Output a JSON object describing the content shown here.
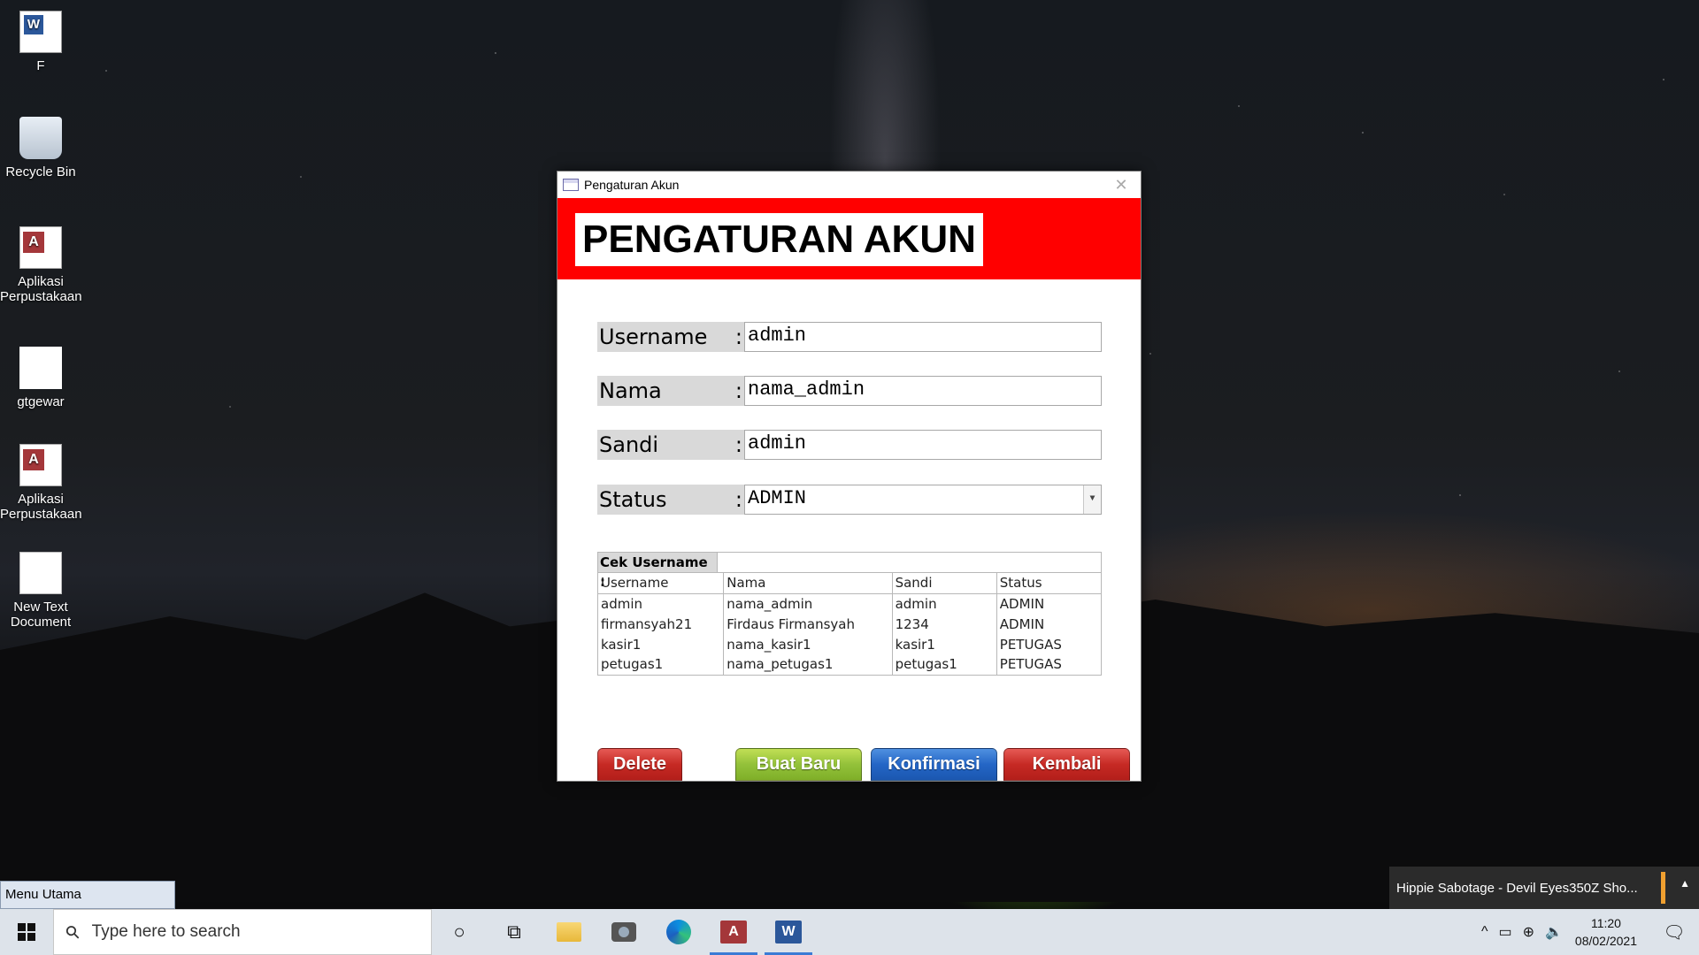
{
  "desktop": {
    "icons": [
      {
        "label": "F",
        "icon": "word-document-icon"
      },
      {
        "label": "Recycle Bin",
        "icon": "recycle-bin-icon"
      },
      {
        "label": "Aplikasi Perpustakaan",
        "icon": "access-database-icon"
      },
      {
        "label": "gtgewar",
        "icon": "blank-file-icon"
      },
      {
        "label": "Aplikasi Perpustakaan",
        "icon": "access-locked-database-icon"
      },
      {
        "label": "New Text Document",
        "icon": "text-document-icon"
      }
    ]
  },
  "window": {
    "title": "Pengaturan Akun",
    "header": "PENGATURAN AKUN",
    "fields": [
      {
        "label": "Username",
        "value": "admin"
      },
      {
        "label": "Nama",
        "value": "nama_admin"
      },
      {
        "label": "Sandi",
        "value": "admin"
      },
      {
        "label": "Status",
        "value": "ADMIN"
      }
    ],
    "colon": ":",
    "cek_label": "Cek Username :",
    "cek_value": "",
    "table": {
      "headers": [
        "Username",
        "Nama",
        "Sandi",
        "Status"
      ],
      "rows": [
        [
          "admin",
          "nama_admin",
          "admin",
          "ADMIN"
        ],
        [
          "firmansyah21",
          "Firdaus Firmansyah",
          "1234",
          "ADMIN"
        ],
        [
          "kasir1",
          "nama_kasir1",
          "kasir1",
          "PETUGAS"
        ],
        [
          "petugas1",
          "nama_petugas1",
          "petugas1",
          "PETUGAS"
        ]
      ]
    },
    "buttons": {
      "delete": "Delete",
      "new": "Buat Baru",
      "confirm": "Konfirmasi",
      "back": "Kembali"
    },
    "colors": {
      "header": "#ff0000",
      "red_button": "#c62a24",
      "green_button": "#93c13a",
      "blue_button": "#2466c6"
    }
  },
  "minimized_form": "Menu Utama",
  "notification": "Hippie Sabotage - Devil Eyes350Z Sho...",
  "taskbar": {
    "search_placeholder": "Type here to search",
    "time": "11:20",
    "date": "08/02/2021"
  }
}
